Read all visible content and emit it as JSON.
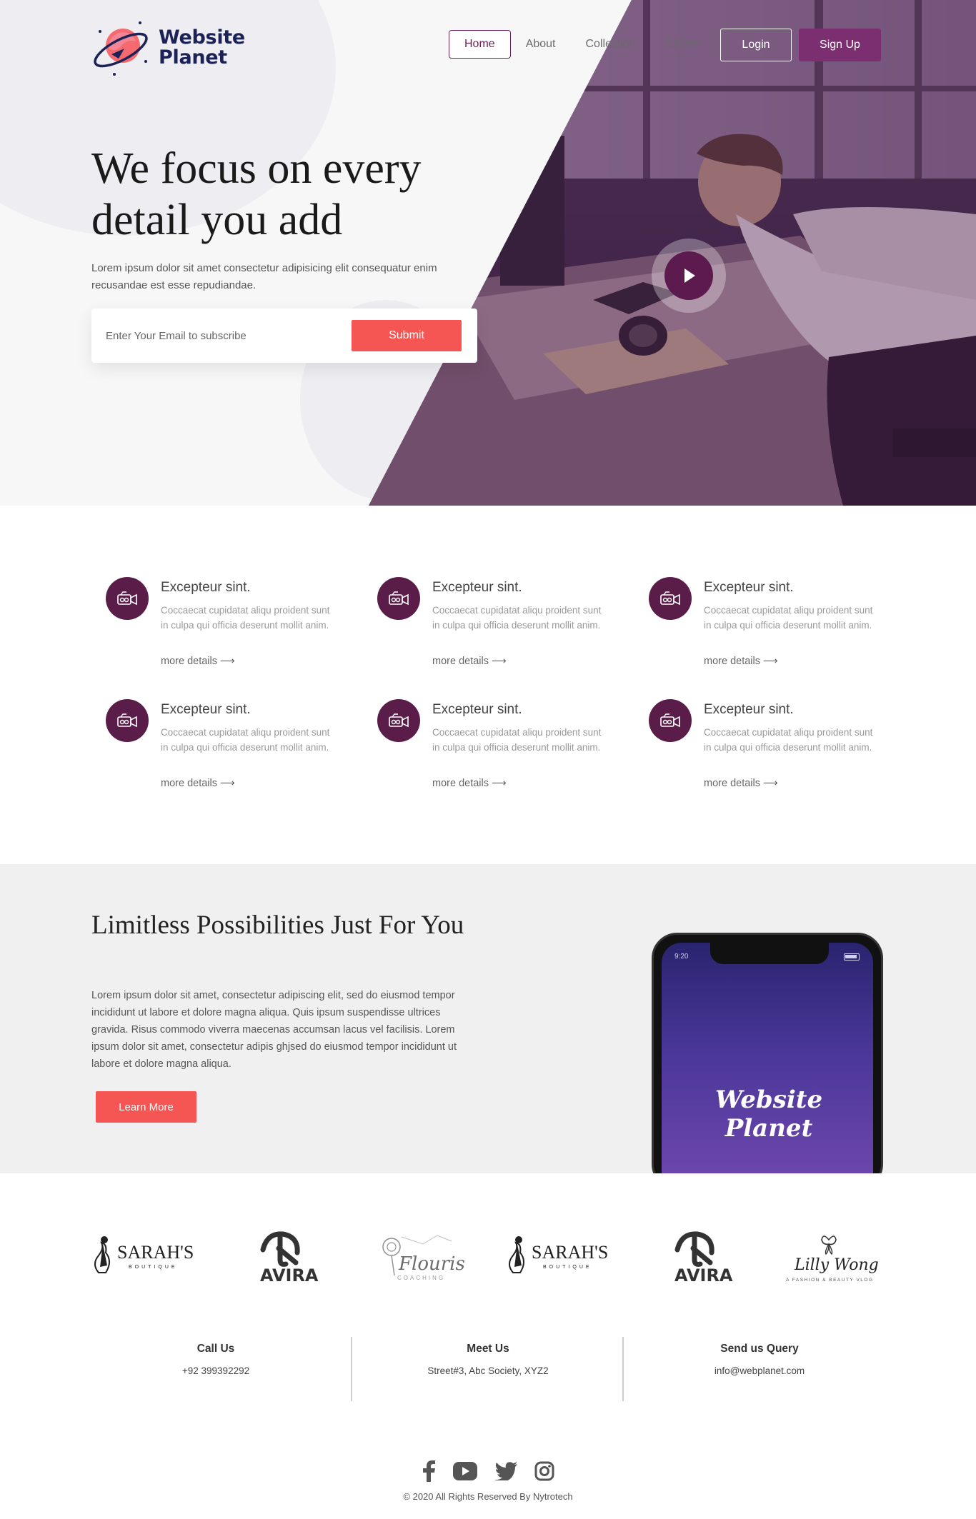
{
  "brand": {
    "name_line1": "Website",
    "name_line2": "Planet"
  },
  "nav": {
    "items": [
      {
        "label": "Home",
        "active": true
      },
      {
        "label": "About"
      },
      {
        "label": "Collection"
      },
      {
        "label": "Clients"
      }
    ],
    "login_label": "Login",
    "signup_label": "Sign Up"
  },
  "hero": {
    "title": "We focus on every detail you add",
    "description": "Lorem ipsum dolor sit amet consectetur adipisicing elit consequatur enim recusandae est esse repudiandae.",
    "email_placeholder": "Enter Your Email to subscribe",
    "submit_label": "Submit",
    "play_icon": "play-icon"
  },
  "features": [
    {
      "title": "Excepteur sint.",
      "description": "Coccaecat cupidatat aliqu proident sunt in culpa qui officia deserunt mollit anim.",
      "link": "more details",
      "icon": "camera-icon"
    },
    {
      "title": "Excepteur sint.",
      "description": "Coccaecat cupidatat aliqu proident sunt in culpa qui officia deserunt mollit anim.",
      "link": "more details",
      "icon": "camera-icon"
    },
    {
      "title": "Excepteur sint.",
      "description": "Coccaecat cupidatat aliqu proident sunt in culpa qui officia deserunt mollit anim.",
      "link": "more details",
      "icon": "camera-icon"
    },
    {
      "title": "Excepteur sint.",
      "description": "Coccaecat cupidatat aliqu proident sunt in culpa qui officia deserunt mollit anim.",
      "link": "more details",
      "icon": "camera-icon"
    },
    {
      "title": "Excepteur sint.",
      "description": "Coccaecat cupidatat aliqu proident sunt in culpa qui officia deserunt mollit anim.",
      "link": "more details",
      "icon": "camera-icon"
    },
    {
      "title": "Excepteur sint.",
      "description": "Coccaecat cupidatat aliqu proident sunt in culpa qui officia deserunt mollit anim.",
      "link": "more details",
      "icon": "camera-icon"
    }
  ],
  "limitless": {
    "title": "Limitless Possibilities Just For You",
    "description": "Lorem ipsum dolor sit amet, consectetur adipiscing elit, sed do eiusmod tempor incididunt ut labore et dolore magna aliqua. Quis ipsum suspendisse ultrices gravida. Risus commodo viverra maecenas accumsan lacus vel facilisis. Lorem ipsum dolor sit amet, consectetur adipis ghjsed do eiusmod tempor incididunt ut labore et dolore magna aliqua.",
    "button_label": "Learn More",
    "phone_time": "9:20",
    "phone_brand": "Website Planet"
  },
  "logos": [
    {
      "name": "SARAH'S",
      "sub": "BOUTIQUE"
    },
    {
      "name": "AVIRA"
    },
    {
      "name": "Flourish",
      "sub": "COACHING"
    },
    {
      "name": "SARAH'S",
      "sub": "BOUTIQUE"
    },
    {
      "name": "AVIRA"
    },
    {
      "name": "Lilly Wong",
      "sub": "A FASHION & BEAUTY VLOG"
    }
  ],
  "contact": [
    {
      "title": "Call Us",
      "value": "+92 399392292"
    },
    {
      "title": "Meet Us",
      "value": "Street#3, Abc Society, XYZ2"
    },
    {
      "title": "Send us Query",
      "value": "info@webplanet.com"
    }
  ],
  "social": [
    "facebook-icon",
    "youtube-icon",
    "twitter-icon",
    "instagram-icon"
  ],
  "footer": {
    "copyright": "© 2020 All Rights Reserved By Nytrotech"
  },
  "colors": {
    "primary": "#5a1d4a",
    "accent": "#f55553",
    "signup": "#7b2f70",
    "navy": "#1c2255"
  }
}
